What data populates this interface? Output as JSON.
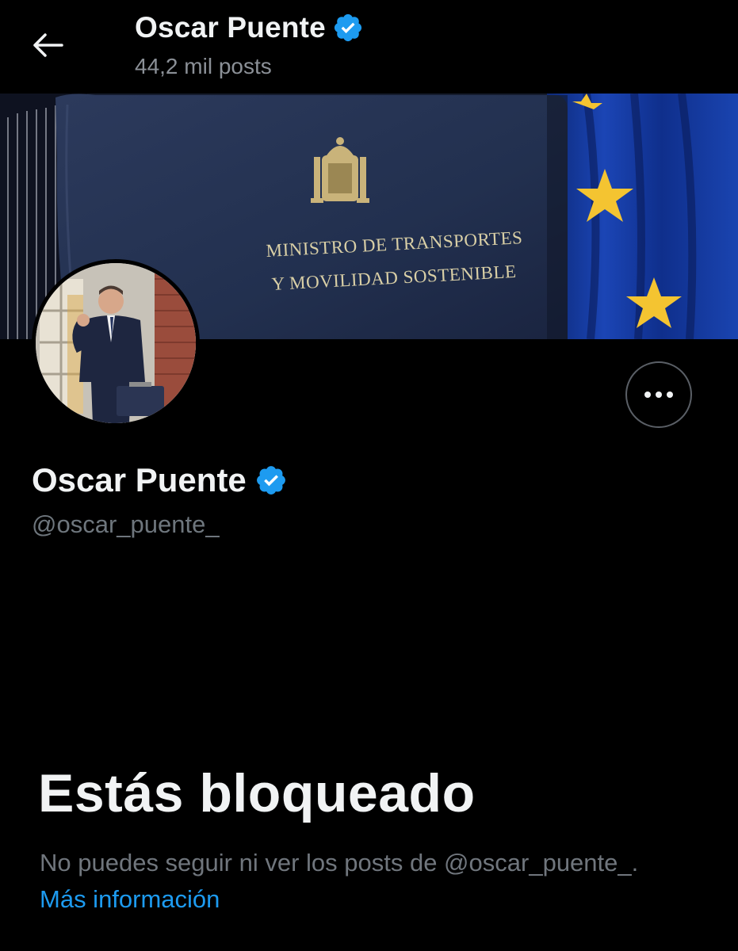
{
  "header": {
    "back_icon": "arrow-left-icon",
    "name": "Oscar Puente",
    "posts_count": "44,2 mil posts"
  },
  "banner": {
    "line1": "MINISTRO DE TRANSPORTES",
    "line2": "Y MOVILIDAD SOSTENIBLE"
  },
  "profile": {
    "name": "Oscar Puente",
    "handle": "@oscar_puente_",
    "verified_icon": "verified-badge-icon",
    "more_icon": "more-options-icon"
  },
  "blocked": {
    "title": "Estás bloqueado",
    "description": "No puedes seguir ni ver los posts de @oscar_puente_.",
    "link": "Más información"
  },
  "colors": {
    "background": "#000000",
    "accent": "#1d9bf0",
    "verified": "#1d9bf0",
    "secondary_text": "#71767b"
  }
}
